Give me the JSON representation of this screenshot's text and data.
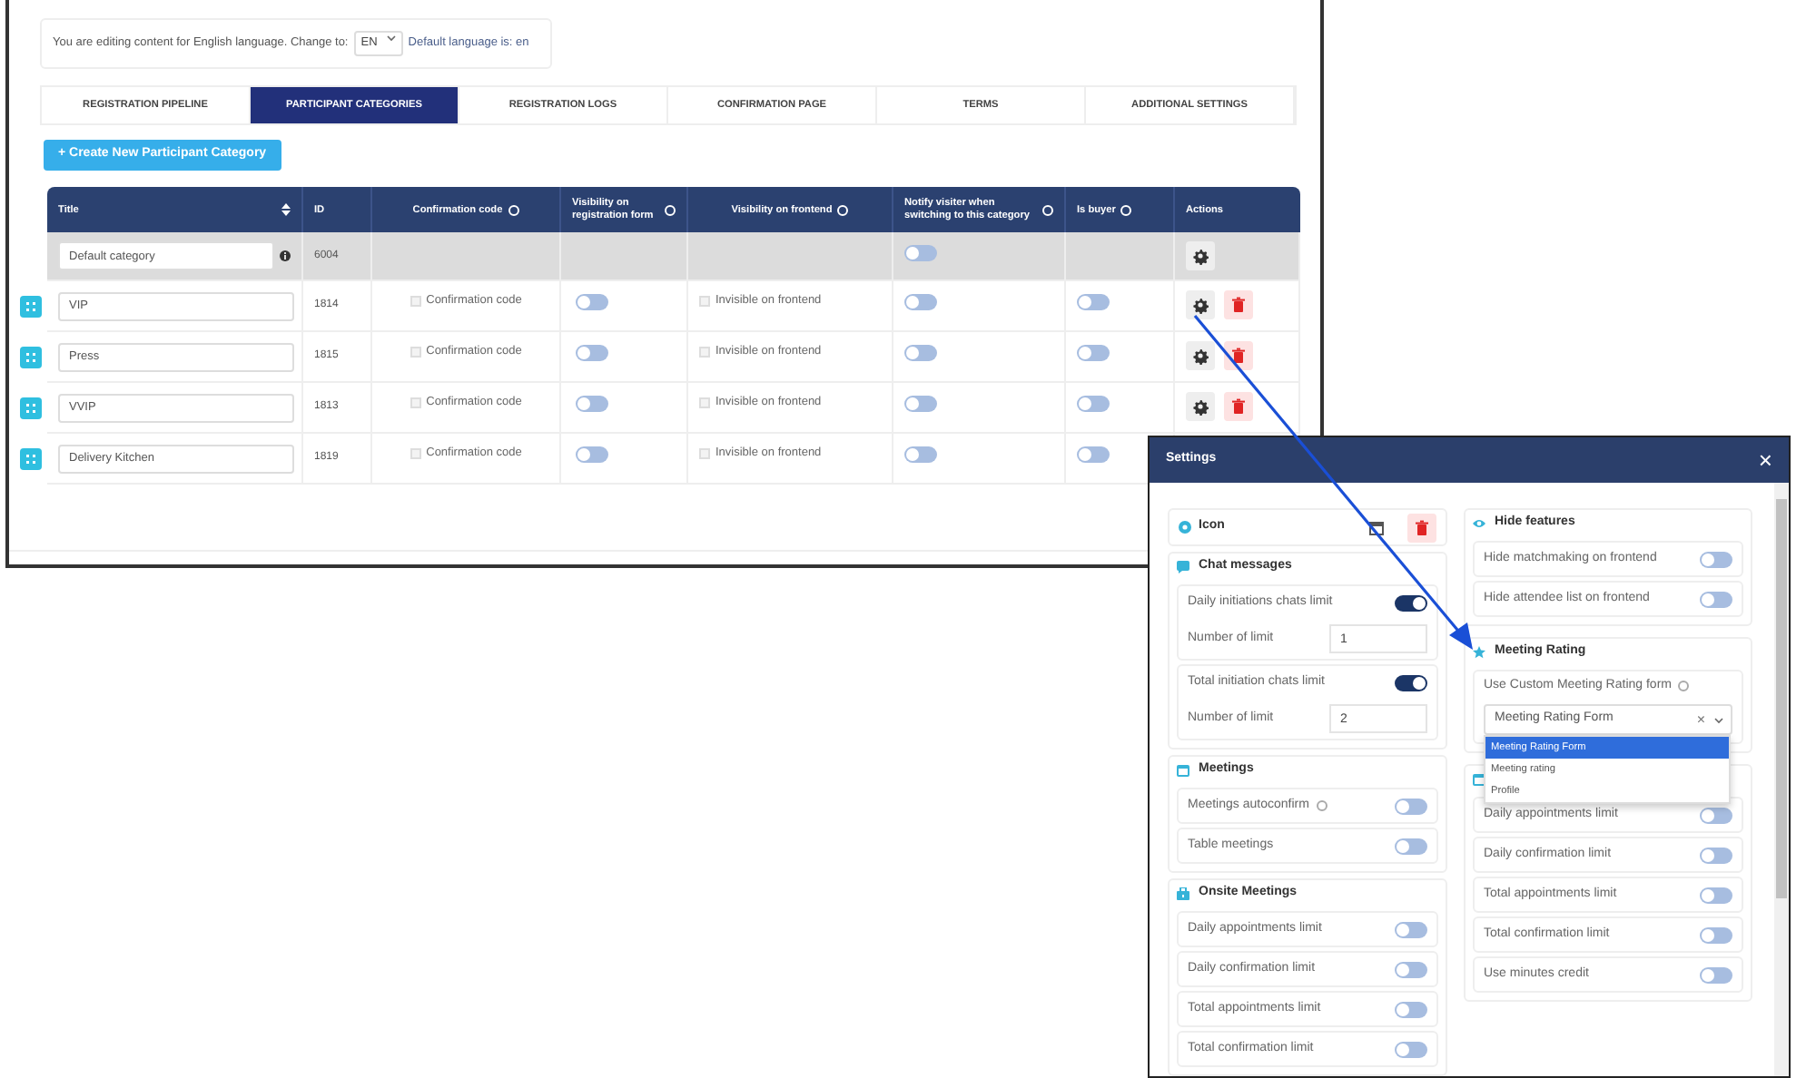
{
  "language_bar": {
    "text": "You are editing content for English language. Change to:",
    "language": "EN",
    "default_language": "Default language is: en"
  },
  "tabs": [
    {
      "label": "REGISTRATION PIPELINE",
      "selected": false
    },
    {
      "label": "PARTICIPANT CATEGORIES",
      "selected": true
    },
    {
      "label": "REGISTRATION LOGS",
      "selected": false
    },
    {
      "label": "CONFIRMATION PAGE",
      "selected": false
    },
    {
      "label": "TERMS",
      "selected": false
    },
    {
      "label": "ADDITIONAL SETTINGS",
      "selected": false
    }
  ],
  "create_button": "+ Create New Participant Category",
  "table": {
    "columns": [
      {
        "label": "Title",
        "sortable": true
      },
      {
        "label": "ID"
      },
      {
        "label": "Confirmation code",
        "info": true
      },
      {
        "label": "Visibility on registration form",
        "info": true
      },
      {
        "label": "Visibility on frontend",
        "info": true
      },
      {
        "label": "Notify visiter when switching to this category",
        "info": true
      },
      {
        "label": "Is buyer",
        "info": true
      },
      {
        "label": "Actions"
      }
    ],
    "default_row": {
      "title": "Default category",
      "id": "6004",
      "notify_on": false
    },
    "rows": [
      {
        "title": "VIP",
        "id": "1814",
        "confirmation": {
          "label": "Confirmation code",
          "checked": false
        },
        "registration_visible": false,
        "frontend": {
          "label": "Invisible on frontend",
          "checked": false
        },
        "notify_on": false,
        "buyer_on": false,
        "actions": true
      },
      {
        "title": "Press",
        "id": "1815",
        "confirmation": {
          "label": "Confirmation code",
          "checked": false
        },
        "registration_visible": false,
        "frontend": {
          "label": "Invisible on frontend",
          "checked": false
        },
        "notify_on": false,
        "buyer_on": false,
        "actions": true
      },
      {
        "title": "VVIP",
        "id": "1813",
        "confirmation": {
          "label": "Confirmation code",
          "checked": false
        },
        "registration_visible": false,
        "frontend": {
          "label": "Invisible on frontend",
          "checked": false
        },
        "notify_on": false,
        "buyer_on": false,
        "actions": true
      },
      {
        "title": "Delivery Kitchen",
        "id": "1819",
        "confirmation": {
          "label": "Confirmation code",
          "checked": false
        },
        "registration_visible": false,
        "frontend": {
          "label": "Invisible on frontend",
          "checked": false
        },
        "notify_on": false,
        "buyer_on": false
      }
    ]
  },
  "settings": {
    "title": "Settings",
    "close": "×",
    "columns": [
      [
        {
          "kind": "icon",
          "title": "Icon"
        },
        {
          "kind": "group",
          "title": "Chat messages",
          "groups": [
            [
              {
                "kind": "toggle",
                "label": "Daily initiations chats limit",
                "on": true
              },
              {
                "kind": "number",
                "label": "Number of limit",
                "value": "1"
              }
            ],
            [
              {
                "kind": "toggle",
                "label": "Total initiation chats limit",
                "on": true
              },
              {
                "kind": "number",
                "label": "Number of limit",
                "value": "2"
              }
            ]
          ]
        },
        {
          "kind": "group",
          "title": "Meetings",
          "groups": [
            [
              {
                "kind": "toggle",
                "label": "Meetings autoconfirm",
                "on": false,
                "info": true
              }
            ],
            [
              {
                "kind": "toggle",
                "label": "Table meetings",
                "on": false
              }
            ]
          ]
        },
        {
          "kind": "group",
          "title": "Onsite Meetings",
          "groups": [
            [
              {
                "kind": "toggle",
                "label": "Daily appointments limit",
                "on": false
              }
            ],
            [
              {
                "kind": "toggle",
                "label": "Daily confirmation limit",
                "on": false
              }
            ],
            [
              {
                "kind": "toggle",
                "label": "Total appointments limit",
                "on": false
              }
            ],
            [
              {
                "kind": "toggle",
                "label": "Total confirmation limit",
                "on": false
              }
            ]
          ]
        }
      ],
      [
        {
          "kind": "group",
          "title": "Hide features",
          "groups": [
            [
              {
                "kind": "toggle",
                "label": "Hide matchmaking on frontend",
                "on": false
              }
            ],
            [
              {
                "kind": "toggle",
                "label": "Hide attendee list on frontend",
                "on": false
              }
            ]
          ]
        },
        {
          "kind": "group",
          "title": "Meeting Rating",
          "groups": [
            [
              {
                "kind": "select",
                "label": "Use Custom Meeting Rating form",
                "info": true,
                "value": "Meeting Rating Form",
                "clear": "×",
                "expanded": true,
                "options": [
                  {
                    "label": "Meeting Rating Form",
                    "selected": true
                  },
                  {
                    "label": "Meeting rating",
                    "selected": false
                  },
                  {
                    "label": "Profile",
                    "selected": false
                  }
                ]
              }
            ]
          ]
        },
        {
          "kind": "group",
          "groups": [
            [
              {
                "kind": "toggle",
                "label": "Daily appointments limit",
                "on": false
              }
            ],
            [
              {
                "kind": "toggle",
                "label": "Daily confirmation limit",
                "on": false
              }
            ],
            [
              {
                "kind": "toggle",
                "label": "Total appointments limit",
                "on": false
              }
            ],
            [
              {
                "kind": "toggle",
                "label": "Total confirmation limit",
                "on": false
              }
            ],
            [
              {
                "kind": "toggle",
                "label": "Use minutes credit",
                "on": false
              }
            ]
          ]
        }
      ]
    ]
  }
}
